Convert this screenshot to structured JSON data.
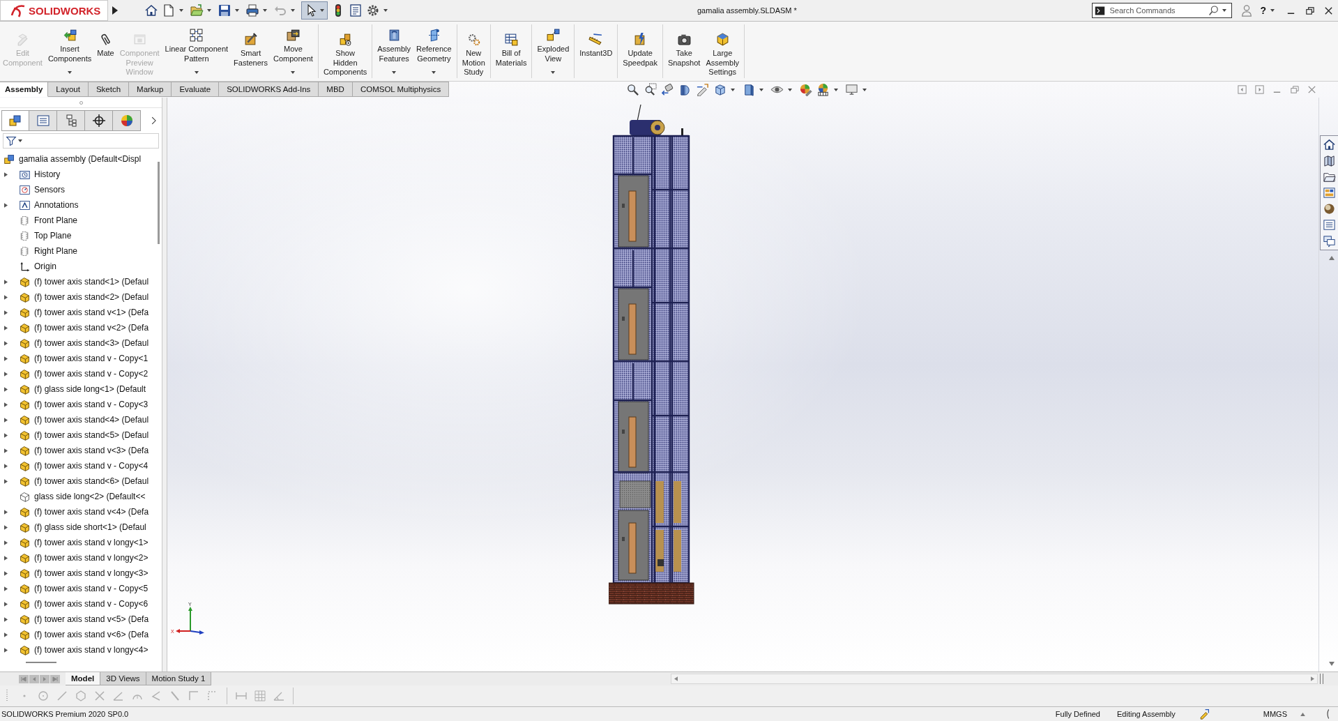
{
  "title_bar": {
    "logo": "SOLIDWORKS",
    "select_pressed": true,
    "document_title": "gamalia assembly.SLDASM *",
    "search": {
      "placeholder": "Search Commands"
    },
    "help": "?"
  },
  "command_manager": {
    "groups": [
      [
        {
          "lines": [
            "Edit",
            "Component"
          ],
          "enabled": false,
          "dropdown": false
        },
        {
          "lines": [
            "Insert",
            "Components"
          ],
          "enabled": true,
          "dropdown": true
        },
        {
          "lines": [
            "Mate"
          ],
          "enabled": true,
          "dropdown": false
        },
        {
          "lines": [
            "Component",
            "Preview",
            "Window"
          ],
          "enabled": false,
          "dropdown": false
        },
        {
          "lines": [
            "Linear Component",
            "Pattern"
          ],
          "enabled": true,
          "dropdown": true
        },
        {
          "lines": [
            "Smart",
            "Fasteners"
          ],
          "enabled": true,
          "dropdown": false
        },
        {
          "lines": [
            "Move",
            "Component"
          ],
          "enabled": true,
          "dropdown": true
        }
      ],
      [
        {
          "lines": [
            "Show",
            "Hidden",
            "Components"
          ],
          "enabled": true,
          "dropdown": false
        }
      ],
      [
        {
          "lines": [
            "Assembly",
            "Features"
          ],
          "enabled": true,
          "dropdown": true
        },
        {
          "lines": [
            "Reference",
            "Geometry"
          ],
          "enabled": true,
          "dropdown": true
        }
      ],
      [
        {
          "lines": [
            "New",
            "Motion",
            "Study"
          ],
          "enabled": true,
          "dropdown": false
        }
      ],
      [
        {
          "lines": [
            "Bill of",
            "Materials"
          ],
          "enabled": true,
          "dropdown": false
        }
      ],
      [
        {
          "lines": [
            "Exploded",
            "View"
          ],
          "enabled": true,
          "dropdown": true
        }
      ],
      [
        {
          "lines": [
            "Instant3D"
          ],
          "enabled": true,
          "dropdown": false
        }
      ],
      [
        {
          "lines": [
            "Update",
            "Speedpak"
          ],
          "enabled": true,
          "dropdown": false
        }
      ],
      [
        {
          "lines": [
            "Take",
            "Snapshot"
          ],
          "enabled": true,
          "dropdown": false
        },
        {
          "lines": [
            "Large",
            "Assembly",
            "Settings"
          ],
          "enabled": true,
          "dropdown": false
        }
      ]
    ]
  },
  "tabs": [
    {
      "label": "Assembly",
      "selected": true
    },
    {
      "label": "Layout",
      "selected": false
    },
    {
      "label": "Sketch",
      "selected": false
    },
    {
      "label": "Markup",
      "selected": false
    },
    {
      "label": "Evaluate",
      "selected": false
    },
    {
      "label": "SOLIDWORKS Add-Ins",
      "selected": false
    },
    {
      "label": "MBD",
      "selected": false
    },
    {
      "label": "COMSOL Multiphysics",
      "selected": false
    }
  ],
  "feature_tree": {
    "panel_tabs": [
      {
        "selected": true
      },
      {
        "selected": false
      },
      {
        "selected": false
      },
      {
        "selected": false
      },
      {
        "selected": false
      }
    ],
    "root": {
      "label": "gamalia assembly (Default<Displ",
      "children": [
        {
          "label": "History",
          "kind": "history",
          "expandable": true
        },
        {
          "label": "Sensors",
          "kind": "sensors",
          "expandable": false
        },
        {
          "label": "Annotations",
          "kind": "annotations",
          "expandable": true
        },
        {
          "label": "Front Plane",
          "kind": "plane",
          "expandable": false
        },
        {
          "label": "Top Plane",
          "kind": "plane",
          "expandable": false
        },
        {
          "label": "Right Plane",
          "kind": "plane",
          "expandable": false
        },
        {
          "label": "Origin",
          "kind": "origin",
          "expandable": false
        },
        {
          "label": "(f) tower axis stand<1> (Defaul",
          "kind": "part",
          "expandable": true
        },
        {
          "label": "(f) tower axis stand<2> (Defaul",
          "kind": "part",
          "expandable": true
        },
        {
          "label": "(f) tower axis stand v<1> (Defa",
          "kind": "part",
          "expandable": true
        },
        {
          "label": "(f) tower axis stand v<2> (Defa",
          "kind": "part",
          "expandable": true
        },
        {
          "label": "(f) tower axis stand<3> (Defaul",
          "kind": "part",
          "expandable": true
        },
        {
          "label": "(f) tower axis stand v - Copy<1",
          "kind": "part",
          "expandable": true
        },
        {
          "label": "(f) tower axis stand v - Copy<2",
          "kind": "part",
          "expandable": true
        },
        {
          "label": "(f) glass side long<1> (Default",
          "kind": "part",
          "expandable": true
        },
        {
          "label": "(f) tower axis stand v - Copy<3",
          "kind": "part",
          "expandable": true
        },
        {
          "label": "(f) tower axis stand<4> (Defaul",
          "kind": "part",
          "expandable": true
        },
        {
          "label": "(f) tower axis stand<5> (Defaul",
          "kind": "part",
          "expandable": true
        },
        {
          "label": "(f) tower axis stand v<3> (Defa",
          "kind": "part",
          "expandable": true
        },
        {
          "label": "(f) tower axis stand v - Copy<4",
          "kind": "part",
          "expandable": true
        },
        {
          "label": "(f) tower axis stand<6> (Defaul",
          "kind": "part",
          "expandable": true
        },
        {
          "label": "glass side long<2> (Default<<",
          "kind": "part-outline",
          "expandable": false
        },
        {
          "label": "(f) tower axis stand v<4> (Defa",
          "kind": "part",
          "expandable": true
        },
        {
          "label": "(f) glass side short<1> (Defaul",
          "kind": "part",
          "expandable": true
        },
        {
          "label": "(f) tower axis stand v longy<1>",
          "kind": "part",
          "expandable": true
        },
        {
          "label": "(f) tower axis stand v longy<2>",
          "kind": "part",
          "expandable": true
        },
        {
          "label": "(f) tower axis stand v longy<3>",
          "kind": "part",
          "expandable": true
        },
        {
          "label": "(f) tower axis stand v - Copy<5",
          "kind": "part",
          "expandable": true
        },
        {
          "label": "(f) tower axis stand v - Copy<6",
          "kind": "part",
          "expandable": true
        },
        {
          "label": "(f) tower axis stand v<5> (Defa",
          "kind": "part",
          "expandable": true
        },
        {
          "label": "(f) tower axis stand v<6> (Defa",
          "kind": "part",
          "expandable": true
        },
        {
          "label": "(f) tower axis stand v longy<4>",
          "kind": "part",
          "expandable": true
        }
      ]
    }
  },
  "triad": {
    "x_label": "X",
    "y_label": "Y"
  },
  "bottom_tabs": [
    {
      "label": "Model",
      "selected": true
    },
    {
      "label": "3D Views",
      "selected": false
    },
    {
      "label": "Motion Study 1",
      "selected": false
    }
  ],
  "status_bar": {
    "product": "SOLIDWORKS Premium 2020 SP0.0",
    "state": "Fully Defined",
    "mode": "Editing Assembly",
    "units": "MMGS"
  }
}
